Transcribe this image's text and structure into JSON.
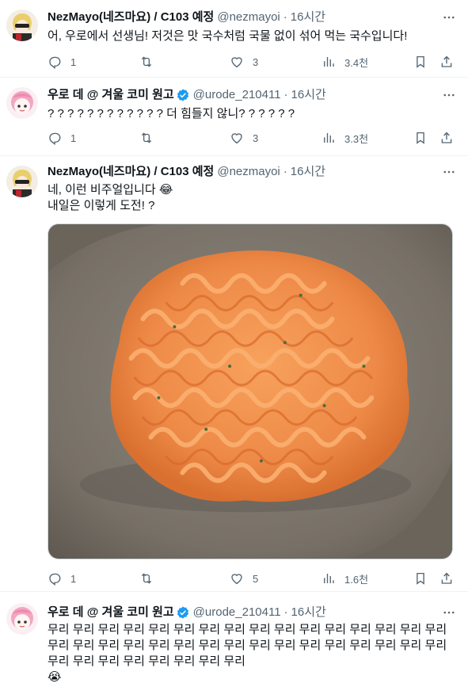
{
  "tweets": [
    {
      "name": "NezMayo(네즈마요) / C103 예정",
      "handle": "@nezmayoi",
      "time": "16시간",
      "verified": false,
      "text": "어, 우로에서 선생님! 저것은 맛 국수처럼 국물 없이 섞어 먹는 국수입니다!",
      "stats": {
        "replies": "1",
        "retweets": "",
        "likes": "3",
        "views": "3.4천"
      }
    },
    {
      "name": "우로 데 @ 겨울 코미 원고",
      "handle": "@urode_210411",
      "time": "16시간",
      "verified": true,
      "text": "? ? ? ? ? ? ? ? ? ? ? ? 더 힘들지 않니? ? ? ? ? ?",
      "stats": {
        "replies": "1",
        "retweets": "",
        "likes": "3",
        "views": "3.3천"
      }
    },
    {
      "name": "NezMayo(네즈마요) / C103 예정",
      "handle": "@nezmayoi",
      "time": "16시간",
      "verified": false,
      "text": "네, 이런 비주얼입니다 😂\n내일은 이렇게 도전! ?",
      "stats": {
        "replies": "1",
        "retweets": "",
        "likes": "5",
        "views": "1.6천"
      }
    },
    {
      "name": "우로 데 @ 겨울 코미 원고",
      "handle": "@urode_210411",
      "time": "16시간",
      "verified": true,
      "text": "무리 무리 무리 무리 무리 무리 무리 무리 무리 무리 무리 무리 무리 무리 무리 무리 무리 무리 무리 무리 무리 무리 무리 무리 무리 무리 무리 무리 무리 무리 무리 무리 무리 무리 무리 무리 무리 무리 무리 무리\n😭"
    }
  ],
  "colors": {
    "text": "#0f1419",
    "muted": "#536471",
    "verified": "#1d9bf0",
    "divider": "#eff3f4"
  },
  "icons": [
    "reply-icon",
    "retweet-icon",
    "like-icon",
    "views-icon",
    "bookmark-icon",
    "share-icon",
    "more-icon",
    "verified-icon"
  ]
}
